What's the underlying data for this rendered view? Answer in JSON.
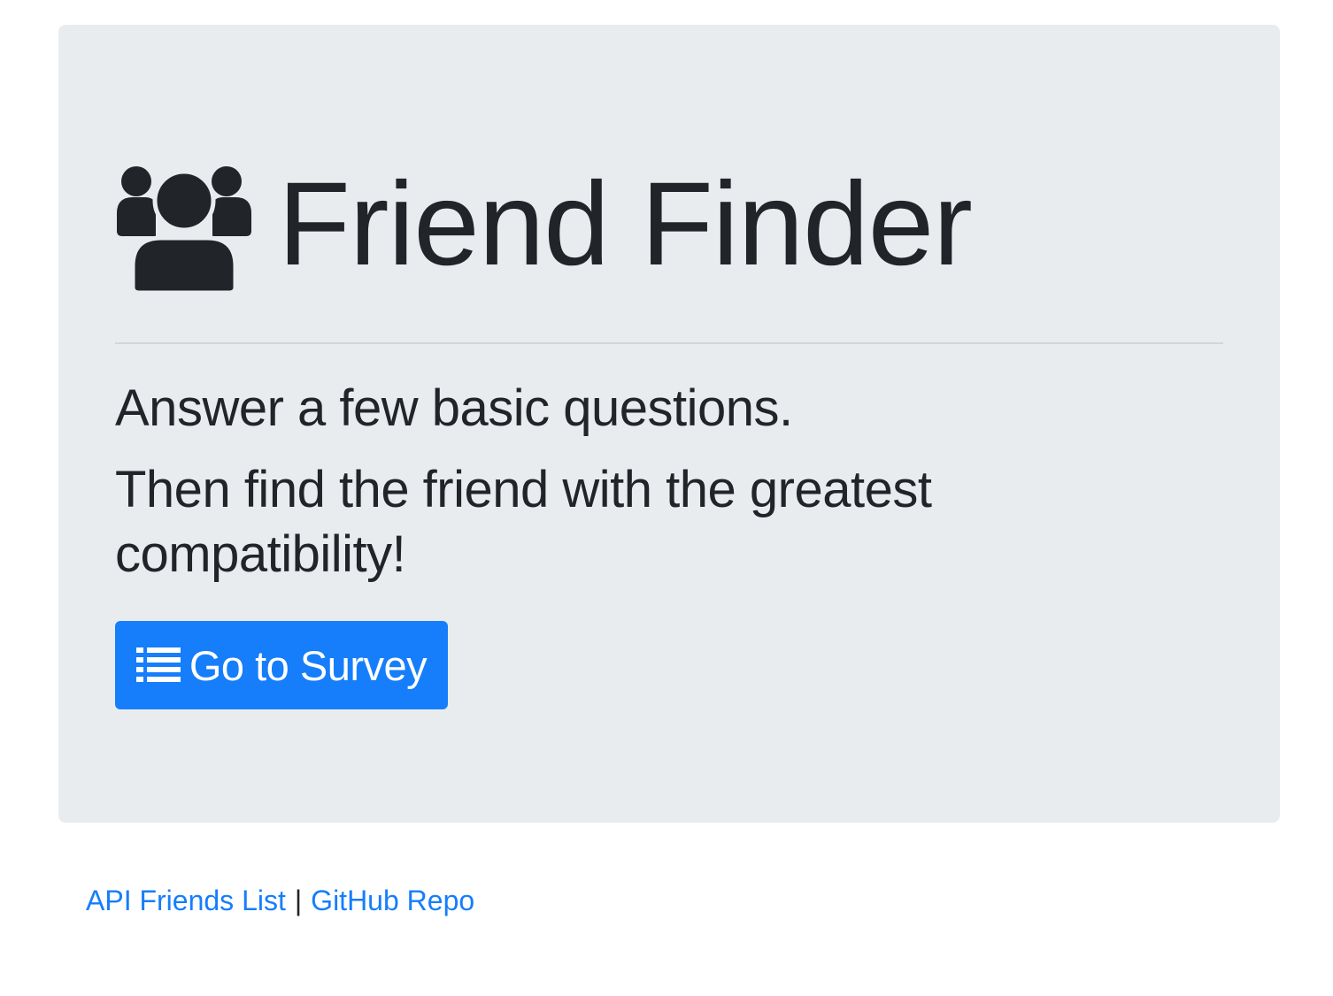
{
  "hero": {
    "title": "Friend Finder",
    "lead_line_1": "Answer a few basic questions.",
    "lead_line_2": "Then find the friend with the greatest compatibility!",
    "button_label": "Go to Survey",
    "title_icon": "users-icon",
    "button_icon": "list-icon"
  },
  "footer": {
    "api_link_label": "API Friends List",
    "separator": "|",
    "github_link_label": "GitHub Repo"
  },
  "colors": {
    "jumbotron_bg": "#e9ecef",
    "primary": "#167efb",
    "text": "#212529"
  }
}
